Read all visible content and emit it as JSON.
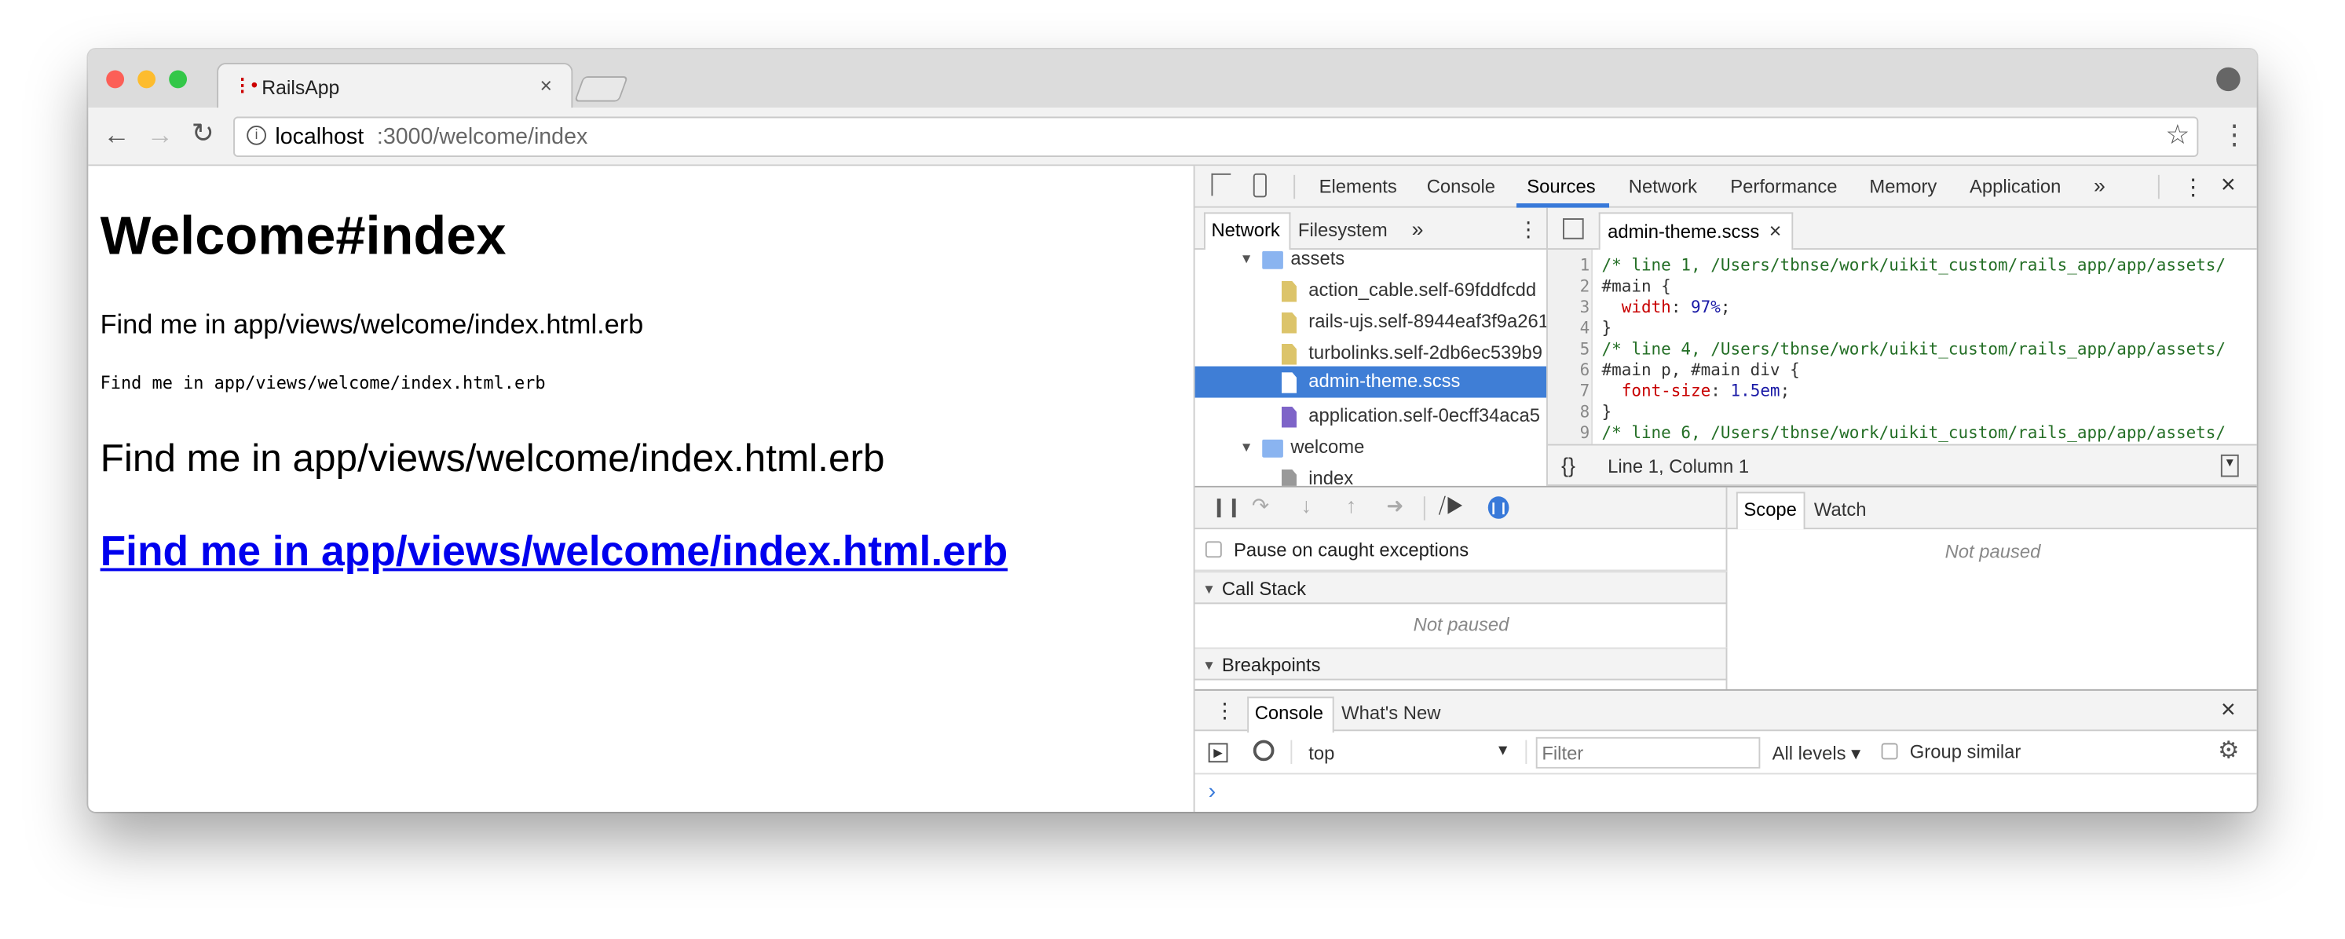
{
  "browser": {
    "tab_title": "RailsApp",
    "url_host": "localhost",
    "url_rest": ":3000/welcome/index",
    "traffic_lights": [
      "#fc5f57",
      "#fdbc2e",
      "#33c748"
    ]
  },
  "page": {
    "heading": "Welcome#index",
    "para1": "Find me in app/views/welcome/index.html.erb",
    "mono": "Find me in app/views/welcome/index.html.erb",
    "para_large": "Find me in app/views/welcome/index.html.erb",
    "link": "Find me in app/views/welcome/index.html.erb",
    "link_color": "#0000ee"
  },
  "devtools": {
    "tabs": [
      "Elements",
      "Console",
      "Sources",
      "Network",
      "Performance",
      "Memory",
      "Application"
    ],
    "active_tab": "Sources",
    "more": "»",
    "navigator_tabs": [
      "Network",
      "Filesystem"
    ],
    "tree": [
      {
        "label": "assets",
        "type": "folder"
      },
      {
        "label": "action_cable.self-69fddfcdd",
        "type": "js"
      },
      {
        "label": "rails-ujs.self-8944eaf3f9a261",
        "type": "js"
      },
      {
        "label": "turbolinks.self-2db6ec539b9",
        "type": "js"
      },
      {
        "label": "admin-theme.scss",
        "type": "scss",
        "selected": true
      },
      {
        "label": "application.self-0ecff34aca5",
        "type": "css"
      },
      {
        "label": "welcome",
        "type": "folder"
      },
      {
        "label": "index",
        "type": "doc"
      }
    ],
    "editor_tab": "admin-theme.scss",
    "code": [
      {
        "n": "1",
        "text": "/* line 1, /Users/tbnse/work/uikit_custom/rails_app/app/assets/"
      },
      {
        "n": "2",
        "text": "#main {"
      },
      {
        "n": "3",
        "prop": "width",
        "val": "97%"
      },
      {
        "n": "4",
        "text": "}"
      },
      {
        "n": "5",
        "text": "/* line 4, /Users/tbnse/work/uikit_custom/rails_app/app/assets/"
      },
      {
        "n": "6",
        "text": "#main p, #main div {"
      },
      {
        "n": "7",
        "prop": "font-size",
        "val": "1.5em"
      },
      {
        "n": "8",
        "text": "}"
      },
      {
        "n": "9",
        "text": "/* line 6, /Users/tbnse/work/uikit_custom/rails_app/app/assets/"
      }
    ],
    "status_braces": "{}",
    "cursor_position": "Line 1, Column 1",
    "pause_caught": "Pause on caught exceptions",
    "call_stack": "Call Stack",
    "not_paused": "Not paused",
    "breakpoints": "Breakpoints",
    "scope_tabs": [
      "Scope",
      "Watch"
    ],
    "drawer_tabs": [
      "Console",
      "What's New"
    ],
    "context": "top",
    "filter_placeholder": "Filter",
    "levels": "All levels ▾",
    "group_similar": "Group similar",
    "prompt": "›",
    "accent": "#3879d9"
  }
}
